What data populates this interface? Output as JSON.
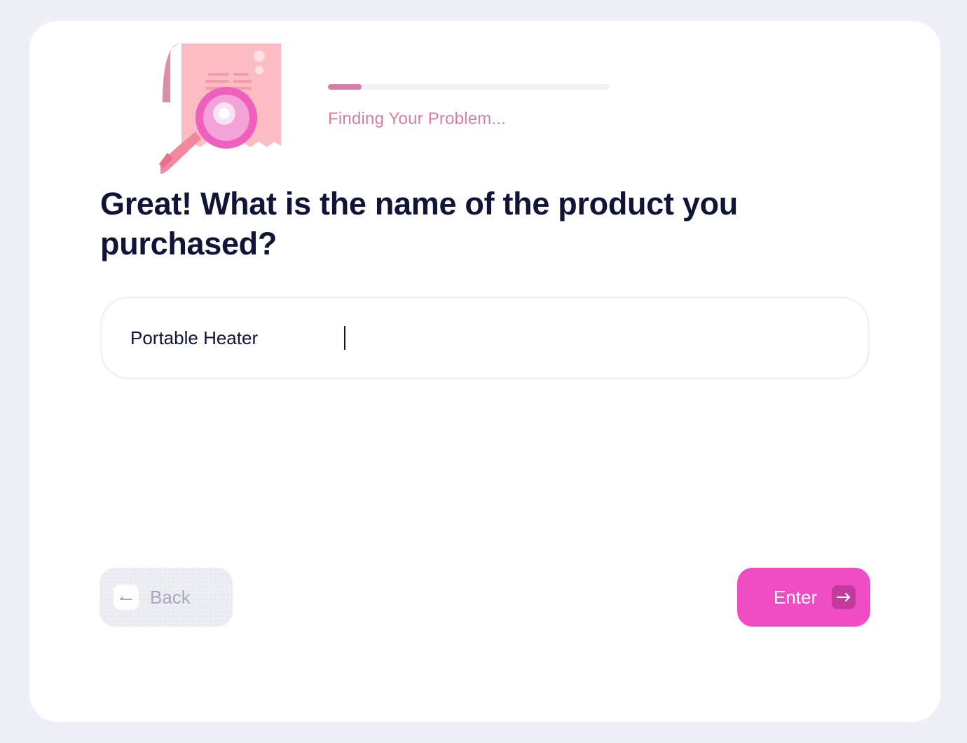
{
  "progress": {
    "fraction": 0.12,
    "status_text": "Finding Your Problem..."
  },
  "question": {
    "text": "Great! What is the name of the product you purchased?"
  },
  "product_input": {
    "value": "Portable Heater"
  },
  "navigation": {
    "back_label": "Back",
    "enter_label": "Enter"
  },
  "colors": {
    "accent_pink": "#f04dc4",
    "progress_pink": "#d77fa4",
    "heading_navy": "#101538",
    "background": "#eef0f8"
  },
  "icons": {
    "illustration": "receipt-magnifier-illustration",
    "back": "arrow-left-icon",
    "enter": "arrow-right-icon"
  }
}
